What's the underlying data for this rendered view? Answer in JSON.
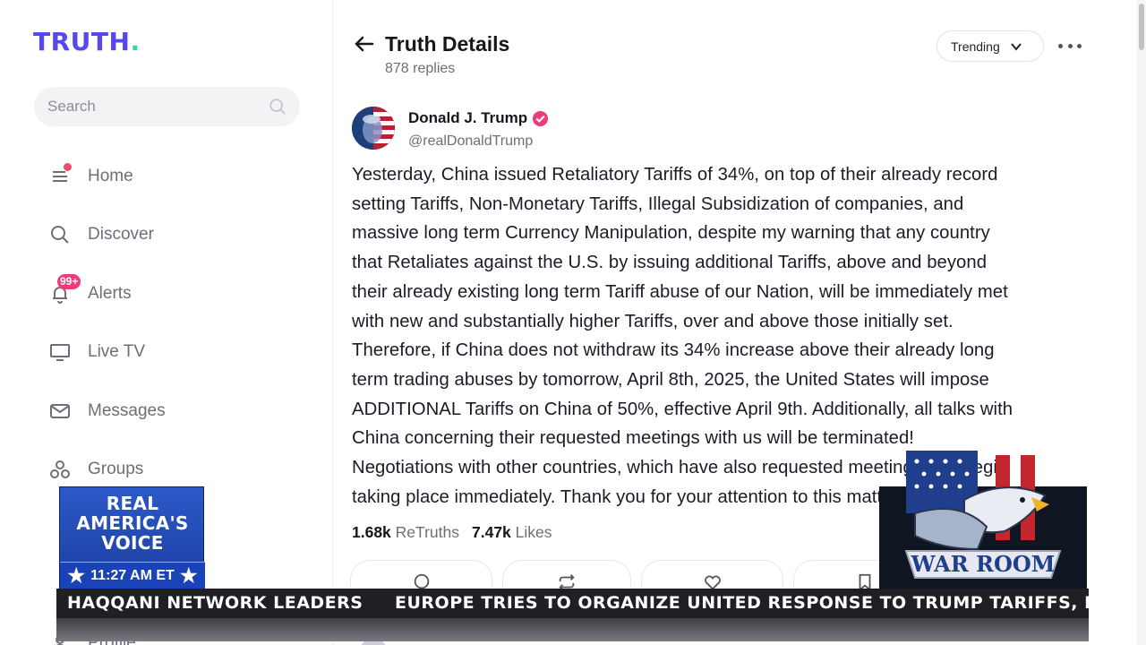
{
  "sidebar": {
    "logo": "TRUTH",
    "logo_dot": ".",
    "search_placeholder": "Search",
    "items": [
      {
        "label": "Home"
      },
      {
        "label": "Discover"
      },
      {
        "label": "Alerts",
        "badge": "99+"
      },
      {
        "label": "Live TV"
      },
      {
        "label": "Messages"
      },
      {
        "label": "Groups"
      },
      {
        "label": "Profile"
      }
    ]
  },
  "header": {
    "title": "Truth Details",
    "subtitle": "878 replies",
    "sort_label": "Trending"
  },
  "post": {
    "author_name": "Donald J. Trump",
    "author_handle": "@realDonaldTrump",
    "lines": [
      "Yesterday, China issued Retaliatory Tariffs of 34%, on top of their already record",
      "setting Tariffs, Non-Monetary Tariffs, Illegal Subsidization of companies, and",
      "massive long term Currency Manipulation, despite my warning that any country",
      "that Retaliates against the U.S. by issuing additional Tariffs, above and beyond",
      "their already existing long term Tariff abuse of our Nation, will be immediately met",
      "with new and substantially higher Tariffs, over and above those initially set.",
      "Therefore, if China does not withdraw its 34% increase above their already long",
      "term trading abuses by tomorrow, April 8th, 2025, the United States will impose",
      "ADDITIONAL Tariffs on China of 50%, effective April 9th. Additionally, all talks with",
      "China concerning their requested meetings with us will be terminated!",
      "Negotiations with other countries, which have also requested meetings, will begin",
      "taking place immediately. Thank you for your attention to this matter!"
    ],
    "retruths_count": "1.68k",
    "retruths_label": "ReTruths",
    "likes_count": "7.47k",
    "likes_label": "Likes"
  },
  "overlay": {
    "network_line1": "REAL",
    "network_line2": "AMERICA'S",
    "network_line3": "VOICE",
    "clock": "11:27 AM ET",
    "show_logo": "WAR ROOM",
    "ticker_left": "HAQQANI NETWORK LEADERS",
    "ticker_right": "EUROPE TRIES TO ORGANIZE UNITED RESPONSE TO TRUMP TARIFFS, BUT"
  },
  "colors": {
    "brand": "#5448ee",
    "brand_dot": "#2bd8a5",
    "badge": "#ec3c7a",
    "verified": "#ec3c7a",
    "network_blue": "#1d3e9e"
  }
}
